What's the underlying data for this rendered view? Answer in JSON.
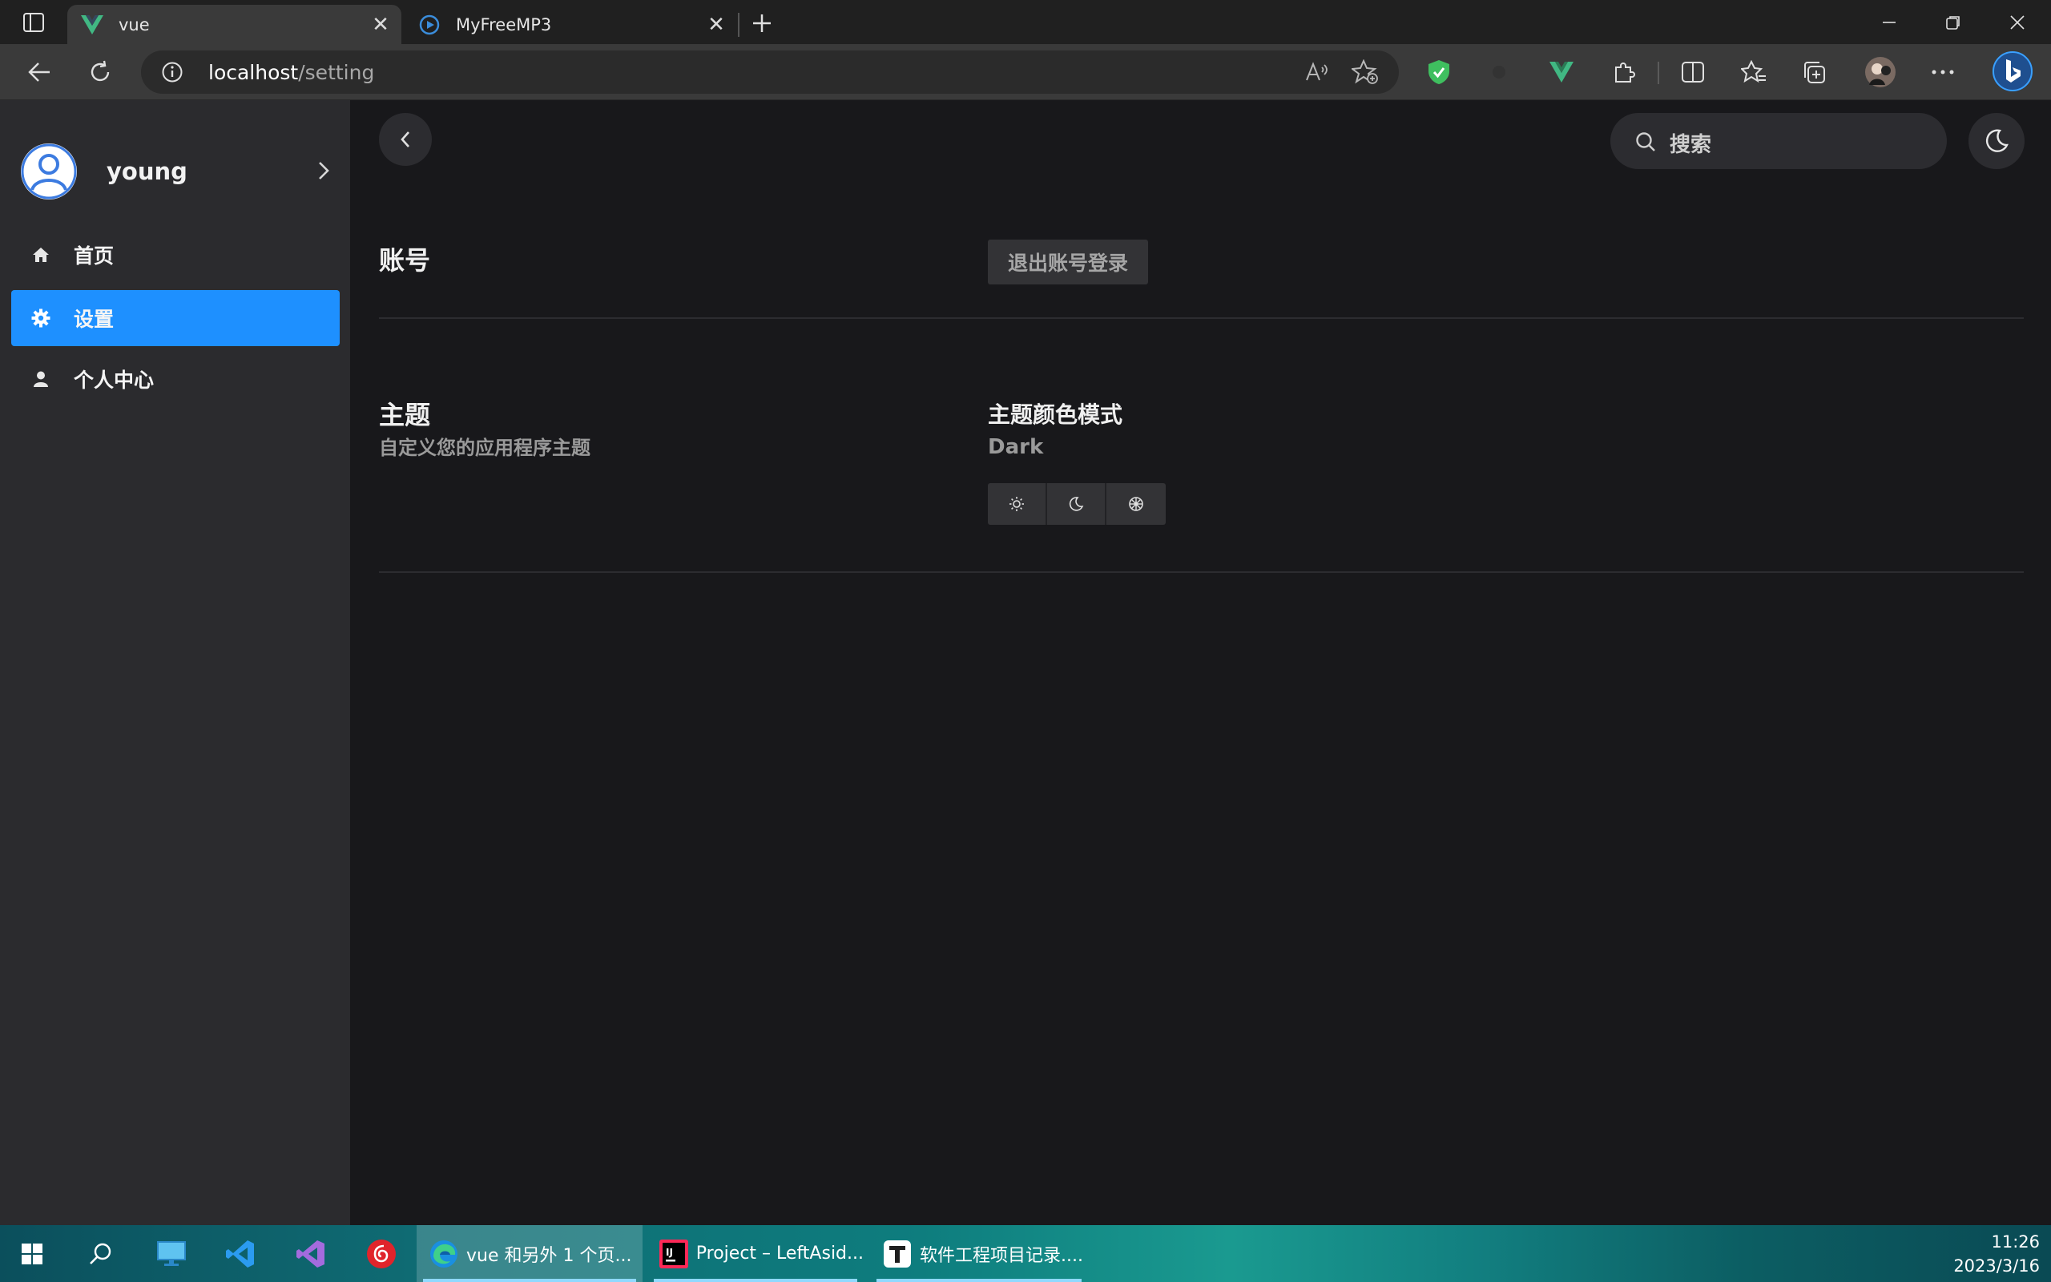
{
  "browser": {
    "tabs": [
      {
        "title": "vue",
        "active": true
      },
      {
        "title": "MyFreeMP3",
        "active": false
      }
    ],
    "address": {
      "host": "localhost",
      "path": "/setting"
    }
  },
  "sidebar": {
    "user": {
      "name": "young"
    },
    "items": [
      {
        "label": "首页",
        "icon": "home-icon",
        "active": false
      },
      {
        "label": "设置",
        "icon": "gear-icon",
        "active": true
      },
      {
        "label": "个人中心",
        "icon": "user-icon",
        "active": false
      }
    ],
    "accent": "#1e90ff"
  },
  "header": {
    "search_placeholder": "搜索"
  },
  "settings": {
    "account": {
      "title": "账号",
      "logout_label": "退出账号登录"
    },
    "theme": {
      "title": "主题",
      "subtitle": "自定义您的应用程序主题",
      "mode_label": "主题颜色模式",
      "mode_value": "Dark",
      "mode_options": [
        "light-icon",
        "dark-icon",
        "auto-icon"
      ]
    }
  },
  "taskbar": {
    "apps": [
      {
        "label": "vue 和另外 1 个页...",
        "active": true
      },
      {
        "label": "Project – LeftAsid...",
        "active": false
      },
      {
        "label": "软件工程项目记录....",
        "active": false
      }
    ],
    "time": "11:26",
    "date": "2023/3/16"
  }
}
